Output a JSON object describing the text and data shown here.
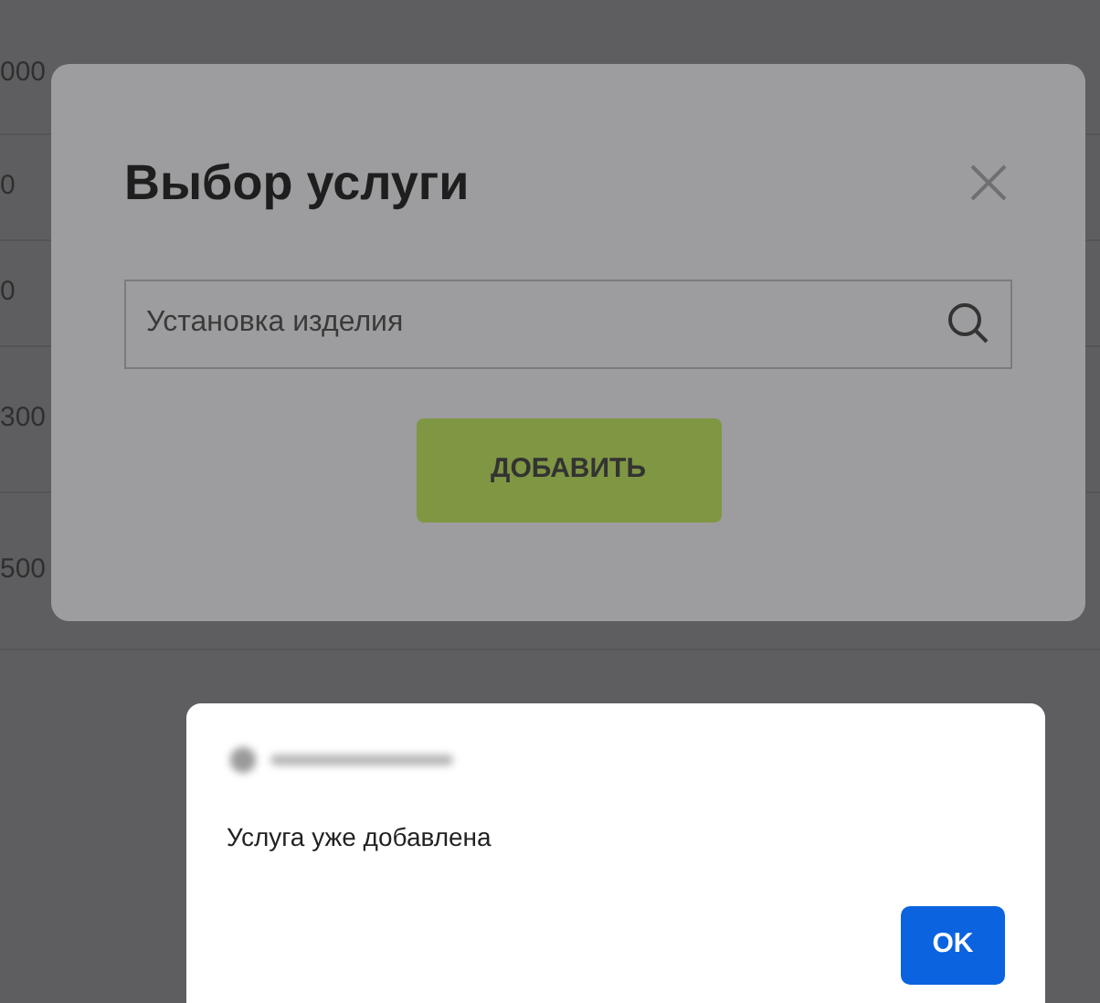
{
  "background_table": {
    "rows": [
      {
        "column_1": "000"
      },
      {
        "column_1": "0"
      },
      {
        "column_1": "0"
      },
      {
        "column_1": "300"
      },
      {
        "column_1": "500"
      }
    ]
  },
  "service_dialog": {
    "title": "Выбор услуги",
    "search": {
      "value": "Установка изделия"
    },
    "add_button": "ДОБАВИТЬ"
  },
  "alert": {
    "message": "Услуга уже добавлена",
    "ok_button": "OK"
  }
}
